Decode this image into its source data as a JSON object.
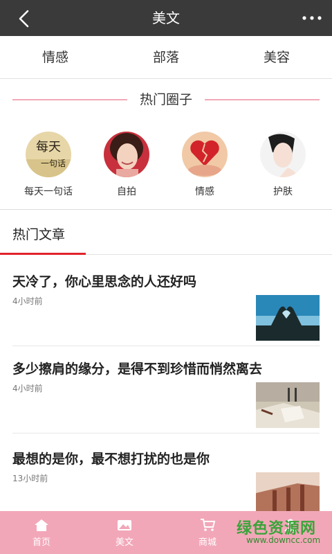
{
  "header": {
    "title": "美文",
    "back_icon": "chevron-left-icon",
    "more_icon": "more-dots-icon"
  },
  "categories": [
    {
      "label": "情感"
    },
    {
      "label": "部落"
    },
    {
      "label": "美容"
    }
  ],
  "hot_circles": {
    "title": "热门圈子",
    "items": [
      {
        "label": "每天一句话",
        "image_text": "每天 一句话"
      },
      {
        "label": "自拍"
      },
      {
        "label": "情感"
      },
      {
        "label": "护肤"
      }
    ]
  },
  "hot_articles": {
    "title": "热门文章",
    "items": [
      {
        "title": "天冷了，你心里思念的人还好吗",
        "time": "4小时前"
      },
      {
        "title": "多少擦肩的缘分，是得不到珍惜而悄然离去",
        "time": "4小时前"
      },
      {
        "title": "最想的是你，最不想打扰的也是你",
        "time": "13小时前"
      }
    ]
  },
  "bottom_nav": [
    {
      "label": "首页",
      "icon": "home-icon"
    },
    {
      "label": "美文",
      "icon": "gallery-icon"
    },
    {
      "label": "商城",
      "icon": "cart-icon"
    },
    {
      "label": "",
      "icon": "user-icon"
    }
  ],
  "watermark": {
    "line1": "绿色资源网",
    "line2": "www.downcc.com"
  },
  "colors": {
    "topbar": "#3a3a3a",
    "accent_red": "#e0232b",
    "pink_line": "#f2a8b8",
    "bottom_nav": "#f2a7b8"
  }
}
